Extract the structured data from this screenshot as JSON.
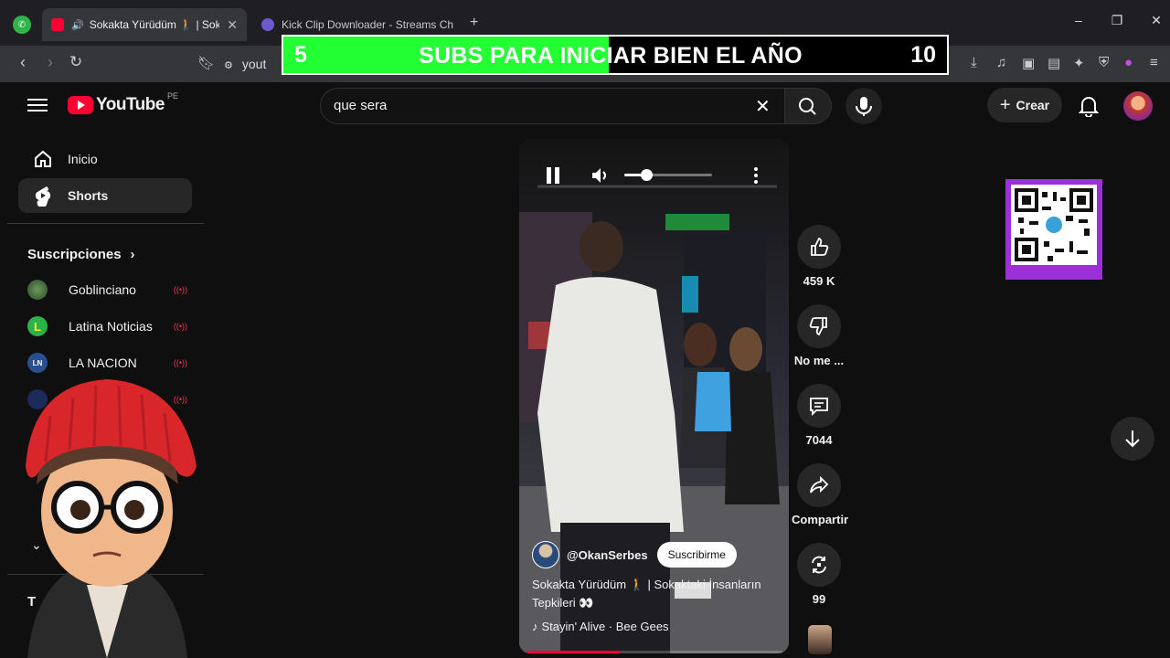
{
  "browser": {
    "tabs": [
      {
        "title": "Sokakta Yürüdüm 🚶 | Sokakta",
        "active": true
      },
      {
        "title": "Kick Clip Downloader - Streams Chart",
        "active": false
      }
    ],
    "address": "yout",
    "new_tab": "+",
    "close": "✕"
  },
  "banner": {
    "left_count": "5",
    "text": "SUBS PARA INICIAR BIEN EL AÑO",
    "right_count": "10",
    "progress": 0.49,
    "accent": "#22ff33"
  },
  "youtube": {
    "logo": "YouTube",
    "country": "PE",
    "search_value": "que sera",
    "create_label": "Crear"
  },
  "sidebar": {
    "items": [
      {
        "label": "Inicio",
        "icon": "home-icon"
      },
      {
        "label": "Shorts",
        "icon": "shorts-icon"
      }
    ],
    "subs_heading": "Suscripciones",
    "subs": [
      {
        "name": "Goblinciano",
        "live": "((•))"
      },
      {
        "name": "Latina Noticias",
        "live": "((•))"
      },
      {
        "name": "LA NACION",
        "live": "((•))"
      },
      {
        "name": "",
        "live": "((•))"
      }
    ],
    "bottom_letter": "T"
  },
  "short": {
    "volume": 0.25,
    "channel": "@OkanSerbes",
    "subscribe": "Suscribirme",
    "title": "Sokakta Yürüdüm 🚶 | Sokaktaki İnsanların Tepkileri 👀",
    "music": "Stayin' Alive · Bee Gees",
    "progress": 0.36
  },
  "actions": {
    "likes": "459 K",
    "dislike": "No me ...",
    "comments": "7044",
    "share": "Compartir",
    "remix": "99"
  }
}
